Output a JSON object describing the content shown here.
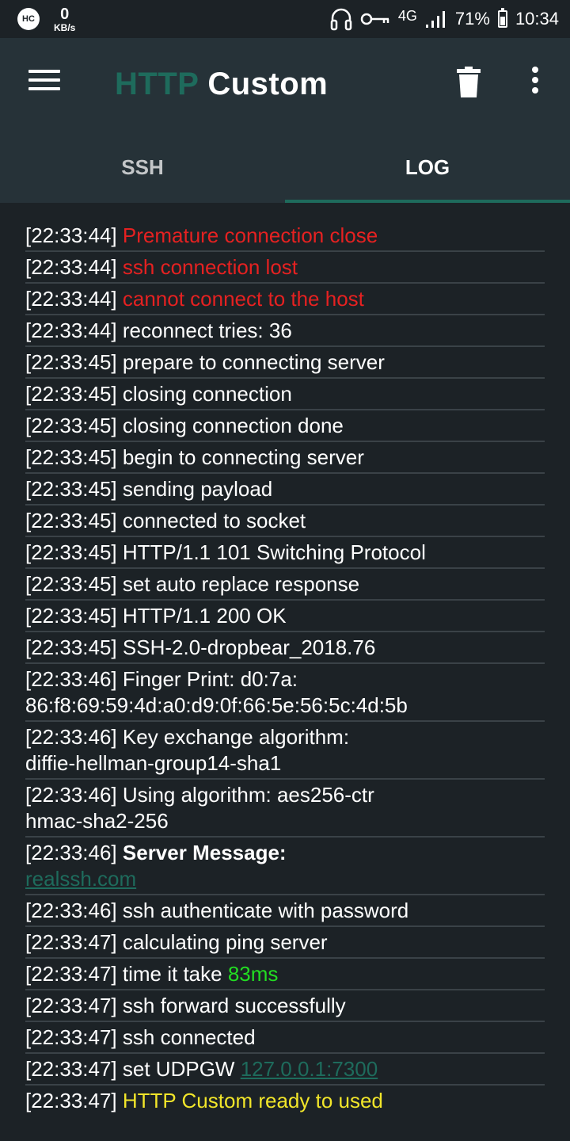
{
  "status_bar": {
    "app_badge": "HC",
    "net_speed_value": "0",
    "net_speed_unit": "KB/s",
    "network_type": "4G",
    "battery_percent": "71%",
    "battery_level": 0.71,
    "time": "10:34",
    "icons": [
      "headphones-icon",
      "vpn-key-icon",
      "signal-icon",
      "battery-icon"
    ]
  },
  "app_bar": {
    "title_part1": "HTTP",
    "title_part2": "Custom",
    "title_part1_color": "#1e6b5c",
    "title_part2_color": "#ffffff",
    "icons": [
      "menu-icon",
      "trash-icon",
      "more-vert-icon"
    ]
  },
  "tabs": [
    {
      "label": "SSH",
      "active": false
    },
    {
      "label": "LOG",
      "active": true
    }
  ],
  "colors": {
    "background": "#1c2226",
    "appbar": "#263238",
    "accent": "#1e6b5c",
    "error": "#e52121",
    "success": "#22dd22",
    "ready": "#f2e62a",
    "divider": "#3a4247"
  },
  "log": [
    {
      "ts": "[22:33:44]",
      "parts": [
        {
          "text": "Premature connection close",
          "style": "red"
        }
      ]
    },
    {
      "ts": "[22:33:44]",
      "parts": [
        {
          "text": "ssh connection lost",
          "style": "red"
        }
      ]
    },
    {
      "ts": "[22:33:44]",
      "parts": [
        {
          "text": "cannot connect to the host",
          "style": "red"
        }
      ]
    },
    {
      "ts": "[22:33:44]",
      "parts": [
        {
          "text": "reconnect tries: 36",
          "style": "white"
        }
      ]
    },
    {
      "ts": "[22:33:45]",
      "parts": [
        {
          "text": "prepare to connecting server",
          "style": "white"
        }
      ]
    },
    {
      "ts": "[22:33:45]",
      "parts": [
        {
          "text": "closing connection",
          "style": "white"
        }
      ]
    },
    {
      "ts": "[22:33:45]",
      "parts": [
        {
          "text": "closing connection done",
          "style": "white"
        }
      ]
    },
    {
      "ts": "[22:33:45]",
      "parts": [
        {
          "text": "begin to connecting server",
          "style": "white"
        }
      ]
    },
    {
      "ts": "[22:33:45]",
      "parts": [
        {
          "text": "sending payload",
          "style": "white"
        }
      ]
    },
    {
      "ts": "[22:33:45]",
      "parts": [
        {
          "text": "connected to socket",
          "style": "white"
        }
      ]
    },
    {
      "ts": "[22:33:45]",
      "parts": [
        {
          "text": "HTTP/1.1 101 Switching Protocol",
          "style": "white"
        }
      ]
    },
    {
      "ts": "[22:33:45]",
      "parts": [
        {
          "text": "set auto replace response",
          "style": "white"
        }
      ]
    },
    {
      "ts": "[22:33:45]",
      "parts": [
        {
          "text": "HTTP/1.1 200 OK",
          "style": "white"
        }
      ]
    },
    {
      "ts": "[22:33:45]",
      "parts": [
        {
          "text": "SSH-2.0-dropbear_2018.76",
          "style": "white"
        }
      ]
    },
    {
      "ts": "[22:33:46]",
      "parts": [
        {
          "text": "Finger Print: d0:7a:",
          "style": "white"
        },
        {
          "text": "86:f8:69:59:4d:a0:d9:0f:66:5e:56:5c:4d:5b",
          "style": "white",
          "newline": true
        }
      ]
    },
    {
      "ts": "[22:33:46]",
      "parts": [
        {
          "text": "Key exchange algorithm:",
          "style": "white"
        },
        {
          "text": "diffie-hellman-group14-sha1",
          "style": "white",
          "newline": true
        }
      ]
    },
    {
      "ts": "[22:33:46]",
      "parts": [
        {
          "text": "Using algorithm: aes256-ctr",
          "style": "white"
        },
        {
          "text": "hmac-sha2-256",
          "style": "white",
          "newline": true
        }
      ]
    },
    {
      "ts": "[22:33:46]",
      "parts": [
        {
          "text": "Server Message:",
          "style": "bold"
        },
        {
          "text": "realssh.com",
          "style": "link",
          "newline": true
        }
      ]
    },
    {
      "ts": "[22:33:46]",
      "parts": [
        {
          "text": "ssh authenticate with password",
          "style": "white"
        }
      ]
    },
    {
      "ts": "[22:33:47]",
      "parts": [
        {
          "text": "calculating ping server",
          "style": "white"
        }
      ]
    },
    {
      "ts": "[22:33:47]",
      "parts": [
        {
          "text": "time it take ",
          "style": "white"
        },
        {
          "text": "83ms",
          "style": "green"
        }
      ]
    },
    {
      "ts": "[22:33:47]",
      "parts": [
        {
          "text": "ssh forward successfully",
          "style": "white"
        }
      ]
    },
    {
      "ts": "[22:33:47]",
      "parts": [
        {
          "text": "ssh connected",
          "style": "white"
        }
      ]
    },
    {
      "ts": "[22:33:47]",
      "parts": [
        {
          "text": "set UDPGW ",
          "style": "white"
        },
        {
          "text": "127.0.0.1:7300",
          "style": "link"
        }
      ]
    },
    {
      "ts": "[22:33:47]",
      "parts": [
        {
          "text": "HTTP Custom ready to used",
          "style": "yellow"
        }
      ]
    }
  ]
}
